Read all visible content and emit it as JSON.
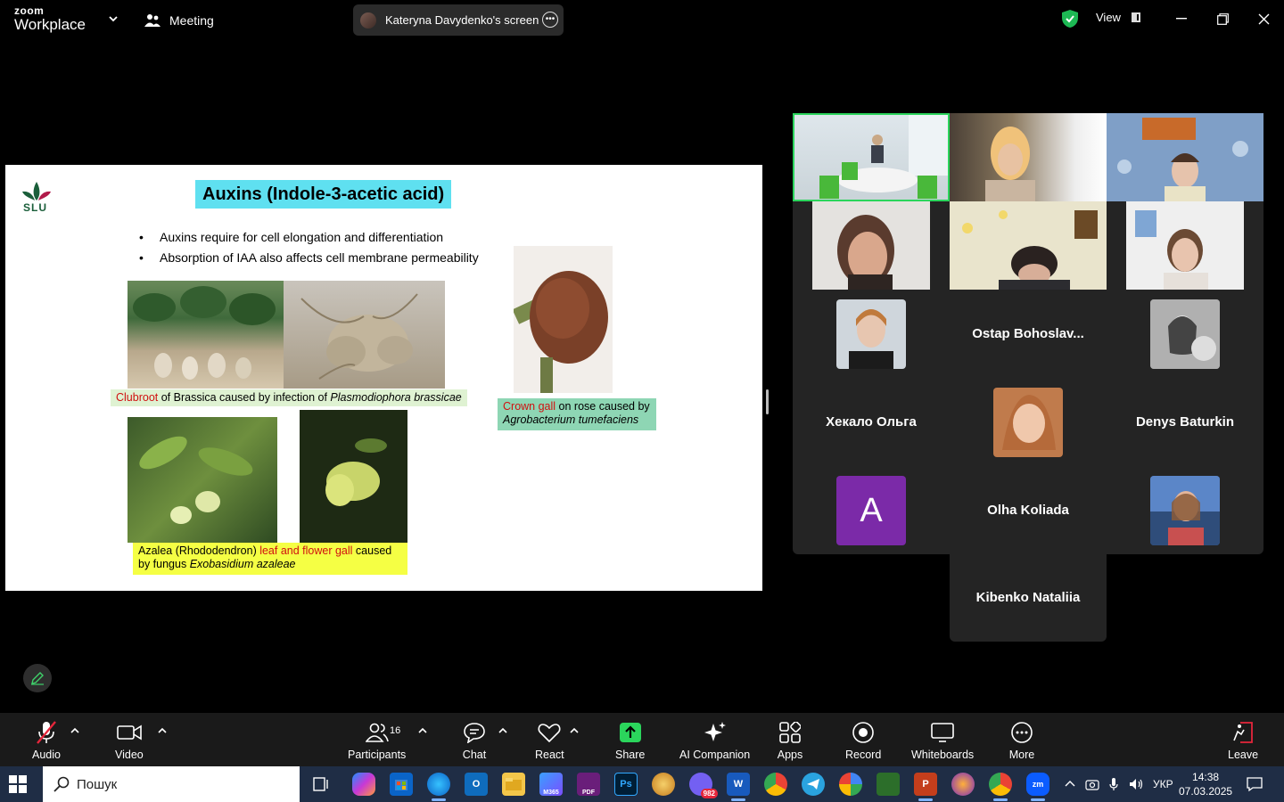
{
  "titlebar": {
    "brand_top": "zoom",
    "brand_bottom": "Workplace",
    "meeting_label": "Meeting",
    "screen_share_label": "Kateryna Davydenko's screen",
    "view_label": "View"
  },
  "slide": {
    "logo_text": "SLU",
    "title": "Auxins (Indole-3-acetic acid)",
    "bullets": [
      "Auxins require for cell elongation and differentiation",
      "Absorption of IAA also affects cell membrane permeability"
    ],
    "caption_clubroot": {
      "red": "Clubroot",
      "rest": " of Brassica caused by infection of ",
      "italic": "Plasmodiophora brassicae"
    },
    "caption_crown": {
      "red": "Crown gall",
      "rest": " on rose caused by",
      "italic": "Agrobacterium tumefaciens"
    },
    "caption_azalea": {
      "pre": "Azalea (Rhododendron) ",
      "red": "leaf and flower gall",
      "post": " caused",
      "line2_pre": "by fungus ",
      "italic": "Exobasidium azaleae"
    },
    "colors": {
      "title_bg": "#5fe0f0",
      "crown_bg": "#8ed6b4",
      "clubroot_bg": "#dff2d2",
      "azalea_bg": "#f5ff44"
    }
  },
  "participants": {
    "names": {
      "ostap": "Ostap  Bohoslav...",
      "khekalo": "Хекало Ольга",
      "denys": "Denys Baturkin",
      "olha": "Olha Koliada",
      "kibenko": "Kibenko Nataliia"
    },
    "avatar_letter": "A"
  },
  "toolbar": {
    "audio": "Audio",
    "video": "Video",
    "participants": "Participants",
    "participants_count": "16",
    "chat": "Chat",
    "react": "React",
    "share": "Share",
    "ai": "AI Companion",
    "apps": "Apps",
    "record": "Record",
    "whiteboards": "Whiteboards",
    "more": "More",
    "leave": "Leave"
  },
  "taskbar": {
    "search_placeholder": "Пошук",
    "viber_badge": "982",
    "lang": "УКР",
    "time": "14:38",
    "date": "07.03.2025",
    "m365_label": "M365",
    "pdf_label": "PDF",
    "ps_label": "Ps",
    "word_label": "W",
    "ppt_label": "P"
  }
}
